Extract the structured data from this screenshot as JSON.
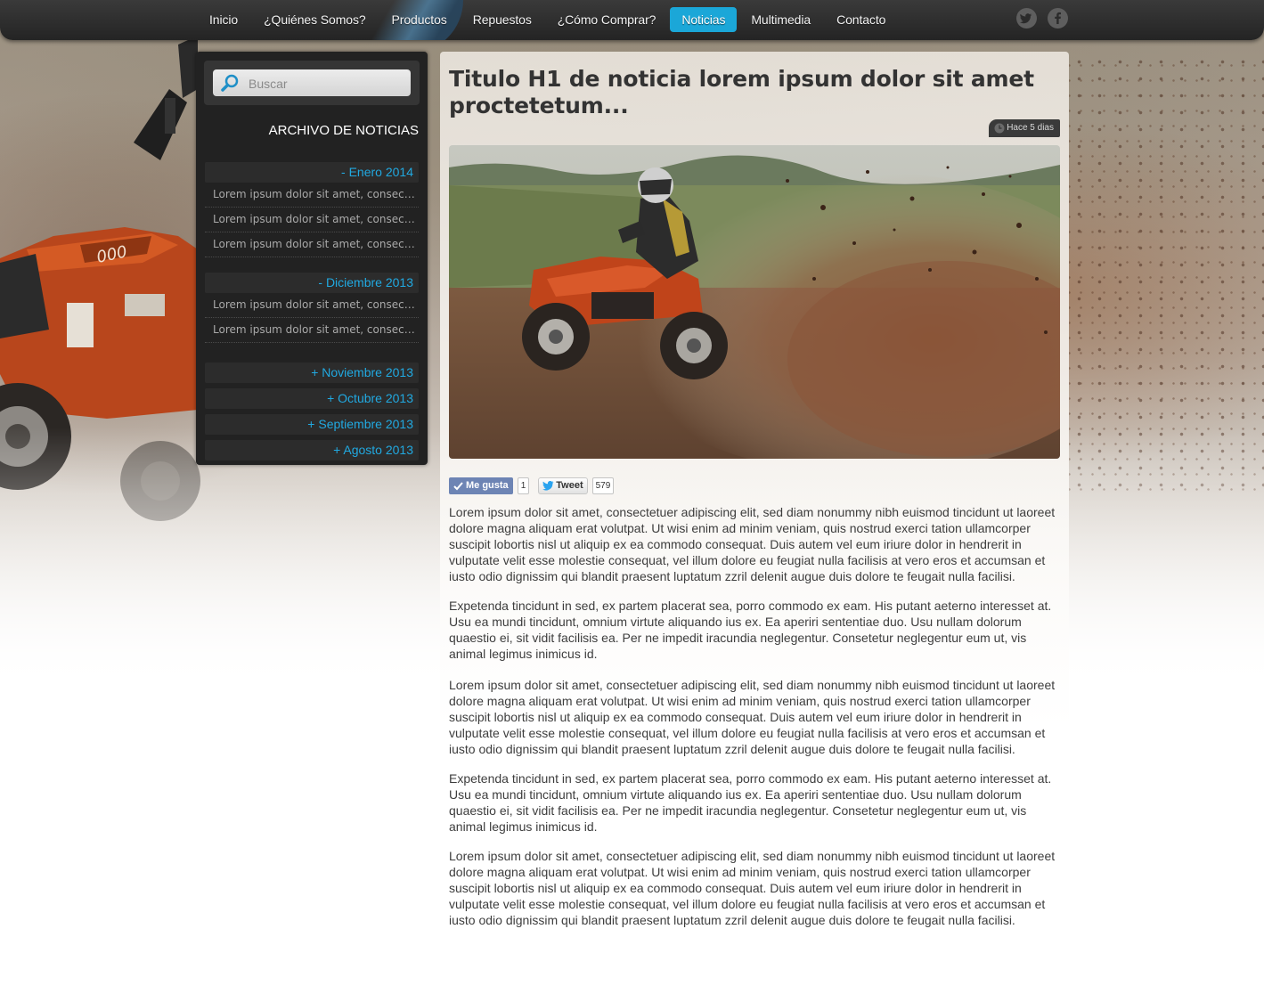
{
  "nav": {
    "items": [
      {
        "label": "Inicio"
      },
      {
        "label": "¿Quiénes Somos?"
      },
      {
        "label": "Productos"
      },
      {
        "label": "Repuestos"
      },
      {
        "label": "¿Cómo Comprar?"
      },
      {
        "label": "Noticias",
        "active": true
      },
      {
        "label": "Multimedia"
      },
      {
        "label": "Contacto"
      }
    ],
    "social": [
      "twitter-icon",
      "facebook-icon"
    ],
    "accent_color": "#1ba7d8"
  },
  "sidebar": {
    "search_placeholder": "Buscar",
    "archive_title": "ARCHIVO DE NOTICIAS",
    "months": [
      {
        "label": "- Enero 2014",
        "items": [
          "Lorem ipsum dolor sit amet, consectetuer adipiscing elit",
          "Lorem ipsum dolor sit amet, consectetuer adipiscing elit",
          "Lorem ipsum dolor sit amet, consectetuer adipiscing elit"
        ]
      },
      {
        "label": "- Diciembre 2013",
        "items": [
          "Lorem ipsum dolor sit amet, consectetuer adipiscing elit",
          "Lorem ipsum dolor sit amet, consectetuer adipiscing elit"
        ]
      },
      {
        "label": "+ Noviembre 2013"
      },
      {
        "label": "+ Octubre 2013"
      },
      {
        "label": "+ Septiembre 2013"
      },
      {
        "label": "+ Agosto 2013"
      }
    ],
    "link_color": "#21a9e1"
  },
  "article": {
    "title": "Titulo H1 de noticia lorem ipsum dolor sit amet proctetetum...",
    "time_ago": "Hace 5 dias",
    "image_alt": "quad-atv-dirt-spray-photo",
    "share": {
      "like_label": "Me gusta",
      "like_count": "1",
      "tweet_label": "Tweet",
      "tweet_count": "579"
    },
    "paragraphs": [
      "Lorem ipsum dolor sit amet, consectetuer adipiscing elit, sed diam nonummy nibh euismod tincidunt ut laoreet dolore magna aliquam erat volutpat. Ut wisi enim ad minim veniam, quis nostrud exerci tation ullamcorper suscipit lobortis nisl ut aliquip ex ea commodo consequat. Duis autem vel eum iriure dolor in hendrerit in vulputate velit esse molestie consequat, vel illum dolore eu feugiat nulla facilisis at vero eros et accumsan et iusto odio dignissim qui blandit praesent luptatum zzril delenit augue duis dolore te feugait nulla facilisi.",
      "Expetenda tincidunt in sed, ex partem placerat sea, porro commodo ex eam. His putant aeterno interesset at. Usu ea mundi tincidunt, omnium virtute aliquando ius ex. Ea aperiri sententiae duo. Usu nullam dolorum quaestio ei, sit vidit facilisis ea. Per ne impedit iracundia neglegentur. Consetetur neglegentur eum ut, vis animal legimus inimicus id.",
      "Lorem ipsum dolor sit amet, consectetuer adipiscing elit, sed diam nonummy nibh euismod tincidunt ut laoreet dolore magna aliquam erat volutpat. Ut wisi enim ad minim veniam, quis nostrud exerci tation ullamcorper suscipit lobortis nisl ut aliquip ex ea commodo consequat. Duis autem vel eum iriure dolor in hendrerit in vulputate velit esse molestie consequat, vel illum dolore eu feugiat nulla facilisis at vero eros et accumsan et iusto odio dignissim qui blandit praesent luptatum zzril delenit augue duis dolore te feugait nulla facilisi.",
      "Expetenda tincidunt in sed, ex partem placerat sea, porro commodo ex eam. His putant aeterno interesset at. Usu ea mundi tincidunt, omnium virtute aliquando ius ex. Ea aperiri sententiae duo. Usu nullam dolorum quaestio ei, sit vidit facilisis ea. Per ne impedit iracundia neglegentur. Consetetur neglegentur eum ut, vis animal legimus inimicus id.",
      "Lorem ipsum dolor sit amet, consectetuer adipiscing elit, sed diam nonummy nibh euismod tincidunt ut laoreet dolore magna aliquam erat volutpat. Ut wisi enim ad minim veniam, quis nostrud exerci tation ullamcorper suscipit lobortis nisl ut aliquip ex ea commodo consequat. Duis autem vel eum iriure dolor in hendrerit in vulputate velit esse molestie consequat, vel illum dolore eu feugiat nulla facilisis at vero eros et accumsan et iusto odio dignissim qui blandit praesent luptatum zzril delenit augue duis dolore te feugait nulla facilisi."
    ]
  }
}
